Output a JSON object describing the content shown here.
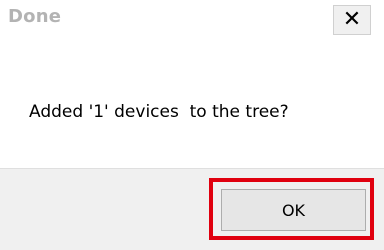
{
  "window": {
    "title": "Done",
    "close_icon": "close-icon"
  },
  "dialog": {
    "message": "Added '1' devices  to the tree?"
  },
  "buttons": {
    "ok_label": "OK"
  },
  "colors": {
    "highlight": "#e0000f",
    "footer_bg": "#f0f0f0",
    "title_text": "#b3b3b3"
  }
}
